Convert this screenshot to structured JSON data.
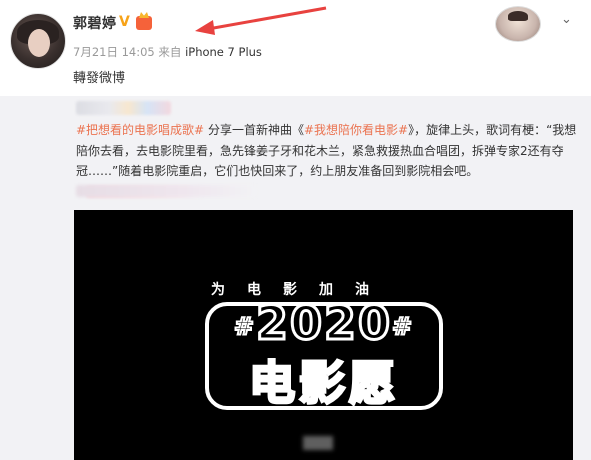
{
  "header": {
    "username": "郭碧婷",
    "verified_badge": "V",
    "date": "7月21日 14:05",
    "source_prefix": "来自",
    "device": "iPhone 7 Plus",
    "repost_label": "轉發微博",
    "avatar_icon": "user-avatar",
    "dropdown_icon": "chevron-down-icon"
  },
  "post": {
    "tag1": "#把想看的电影唱成歌#",
    "text1": " 分享一首新神曲《",
    "tag2": "#我想陪你看电影#",
    "text2": "》，旋律上头，歌词有梗：“我想陪你去看，去电影院里看，急先锋姜子牙和花木兰，紧急救援热血合唱团，拆弹专家2还有夺冠……”随着电影院重启，它们也快回来了，约上朋友准备回到影院相会吧。"
  },
  "video": {
    "tagline": "为电影加油",
    "logo_year": "2020",
    "logo_hash": "#",
    "logo_title": "电影愿"
  },
  "colors": {
    "topic": "#eb7350",
    "verified": "#f7a318",
    "repost_bg": "#f2f2f5",
    "arrow": "#e8423f"
  }
}
